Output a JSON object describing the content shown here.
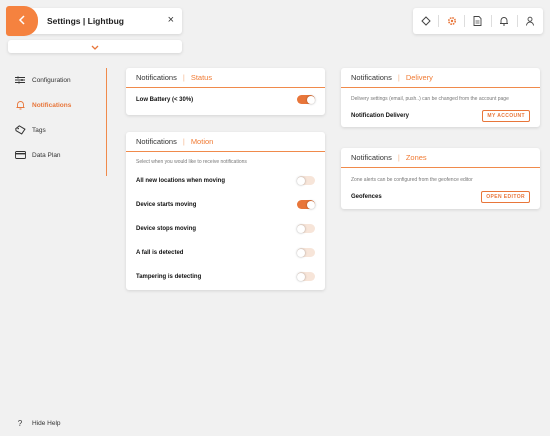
{
  "header": {
    "title": "Settings | Lightbug",
    "close_glyph": "×"
  },
  "sidebar": {
    "items": [
      {
        "label": "Configuration",
        "icon": "sliders-icon"
      },
      {
        "label": "Notifications",
        "icon": "bell-icon",
        "active": true
      },
      {
        "label": "Tags",
        "icon": "tag-icon"
      },
      {
        "label": "Data Plan",
        "icon": "credit-card-icon"
      }
    ],
    "hide_help": "Hide Help"
  },
  "status_card": {
    "title": "Notifications",
    "subtitle": "Status",
    "rows": [
      {
        "label": "Low Battery (< 30%)",
        "on": true
      }
    ]
  },
  "motion_card": {
    "title": "Notifications",
    "subtitle": "Motion",
    "hint": "Select when you would like to receive notifications",
    "rows": [
      {
        "label": "All new locations when moving",
        "on": false
      },
      {
        "label": "Device starts moving",
        "on": true
      },
      {
        "label": "Device stops moving",
        "on": false
      },
      {
        "label": "A fall is detected",
        "on": false
      },
      {
        "label": "Tampering is detecting",
        "on": false
      }
    ]
  },
  "delivery_card": {
    "title": "Notifications",
    "subtitle": "Delivery",
    "hint": "Delivery settings (email, push..) can be changed from the account page",
    "row_label": "Notification Delivery",
    "button": "MY ACCOUNT"
  },
  "zones_card": {
    "title": "Notifications",
    "subtitle": "Zones",
    "hint": "Zone alerts can be configured from the geofence editor",
    "row_label": "Geofences",
    "button": "OPEN EDITOR"
  },
  "top_icons": [
    "locate-icon",
    "gear-icon",
    "document-icon",
    "bell-icon",
    "user-icon"
  ],
  "colors": {
    "accent": "#e8763a",
    "background": "#f1f1f1"
  }
}
